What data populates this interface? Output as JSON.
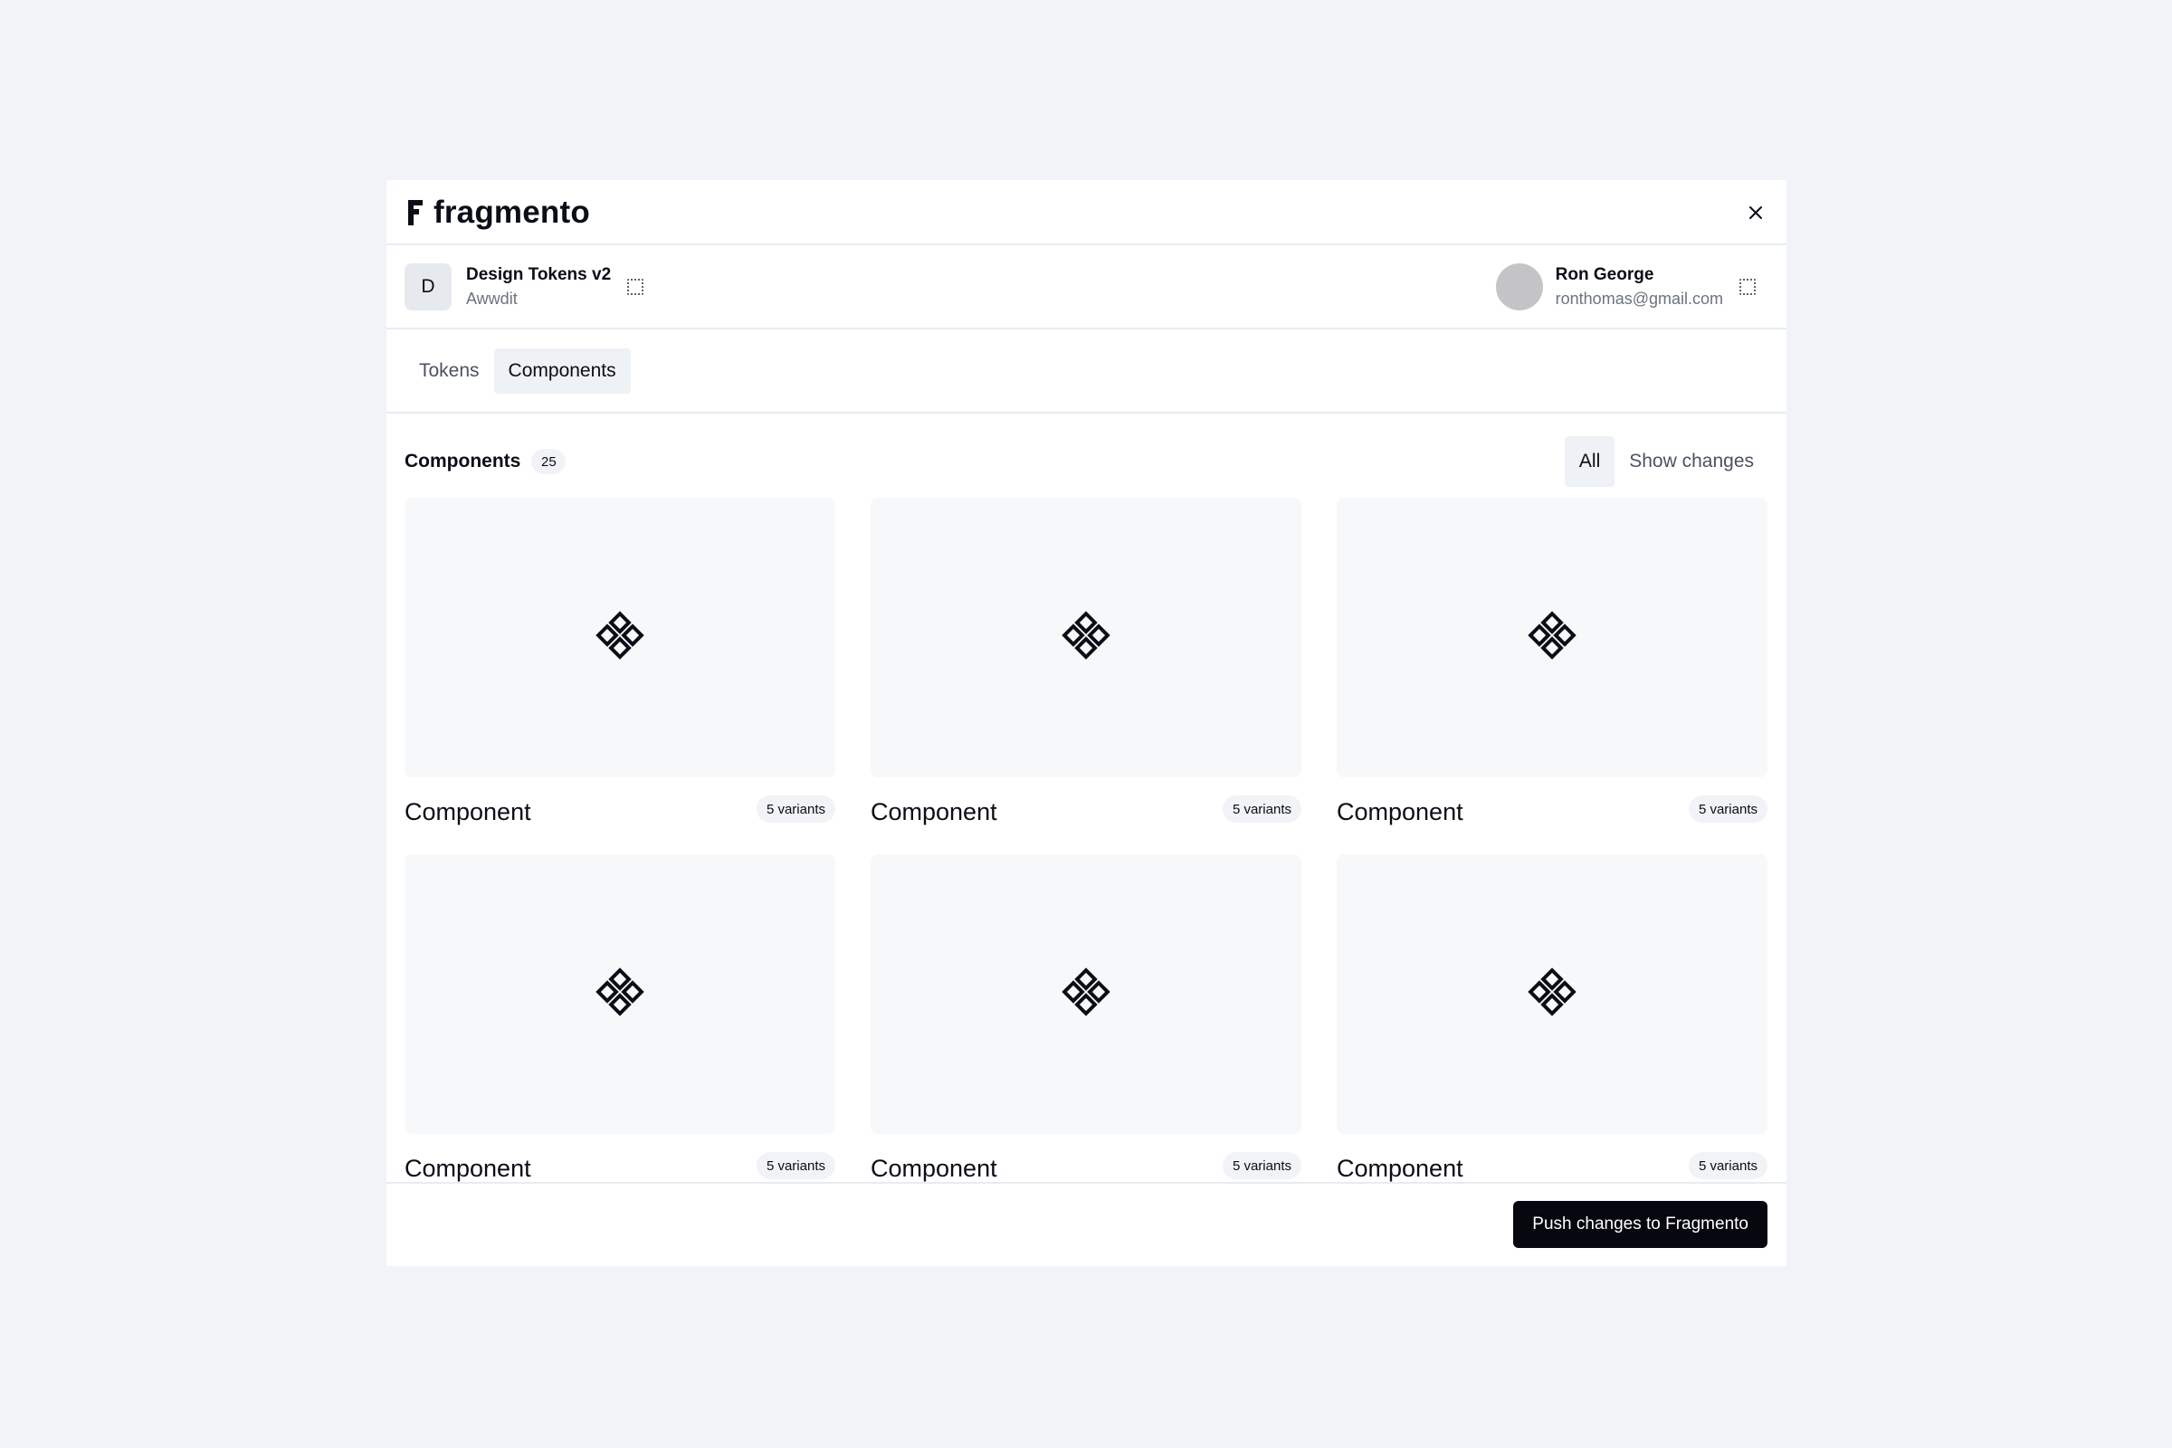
{
  "app": {
    "brand": "fragmento"
  },
  "header": {
    "close_icon": "close-icon"
  },
  "project": {
    "avatar_letter": "D",
    "name": "Design Tokens v2",
    "org": "Awwdit",
    "switch_icon": "dotted-square-icon"
  },
  "user": {
    "name": "Ron George",
    "email": "ronthomas@gmail.com",
    "switch_icon": "dotted-square-icon"
  },
  "tabs": [
    {
      "label": "Tokens",
      "active": false
    },
    {
      "label": "Components",
      "active": true
    }
  ],
  "section": {
    "title": "Components",
    "count": "25"
  },
  "filters": [
    {
      "label": "All",
      "active": true
    },
    {
      "label": "Show changes",
      "active": false
    }
  ],
  "cards": [
    {
      "title": "Component",
      "variants": "5 variants",
      "icon": "component-icon"
    },
    {
      "title": "Component",
      "variants": "5 variants",
      "icon": "component-icon"
    },
    {
      "title": "Component",
      "variants": "5 variants",
      "icon": "component-icon"
    },
    {
      "title": "Component",
      "variants": "5 variants",
      "icon": "component-icon"
    },
    {
      "title": "Component",
      "variants": "5 variants",
      "icon": "component-icon"
    },
    {
      "title": "Component",
      "variants": "5 variants",
      "icon": "component-icon"
    }
  ],
  "footer": {
    "push_label": "Push changes to Fragmento"
  },
  "colors": {
    "page_bg": "#f0f3f8",
    "primary_button": "#06070f",
    "badge_bg": "#f1f3f6",
    "thumb_bg": "#f7f8fa"
  }
}
